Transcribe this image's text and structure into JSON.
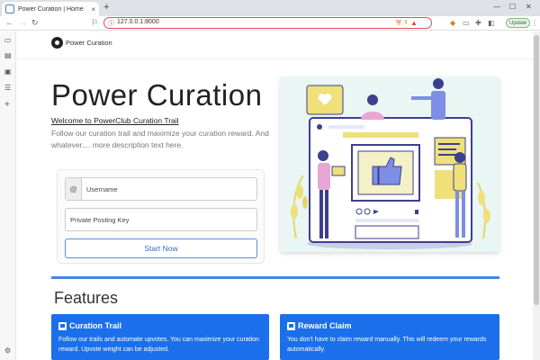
{
  "browser": {
    "tab_title": "Power Curation | Home",
    "tab_close": "×",
    "new_tab": "+",
    "url": "127.0.0.1:8000",
    "update_label": "Update"
  },
  "site": {
    "brand_name": "Power Curation"
  },
  "hero": {
    "title": "Power Curation",
    "link_text": "Welcome to PowerClub Curation Trail",
    "description": "Follow our curation trail and maximize your curation reward. And whatever.... more description text here."
  },
  "login": {
    "username_prefix": "@",
    "username_placeholder": "Username",
    "posting_key_placeholder": "Private Posting Key",
    "start_button": "Start Now"
  },
  "features": {
    "heading": "Features",
    "cards": [
      {
        "title": "Curation Trail",
        "icon": "thumbs-up-icon",
        "description": "Follow our trails and automate upvotes. You can maximize your curation reward. Upvote weight can be adjusted."
      },
      {
        "title": "Reward Claim",
        "icon": "thumbs-up-icon",
        "description": "You don't have to claim reward manually. This will redeem your rewards automatically."
      }
    ]
  },
  "colors": {
    "accent": "#1b6fea",
    "illustration_bg": "#e9f6f4"
  }
}
